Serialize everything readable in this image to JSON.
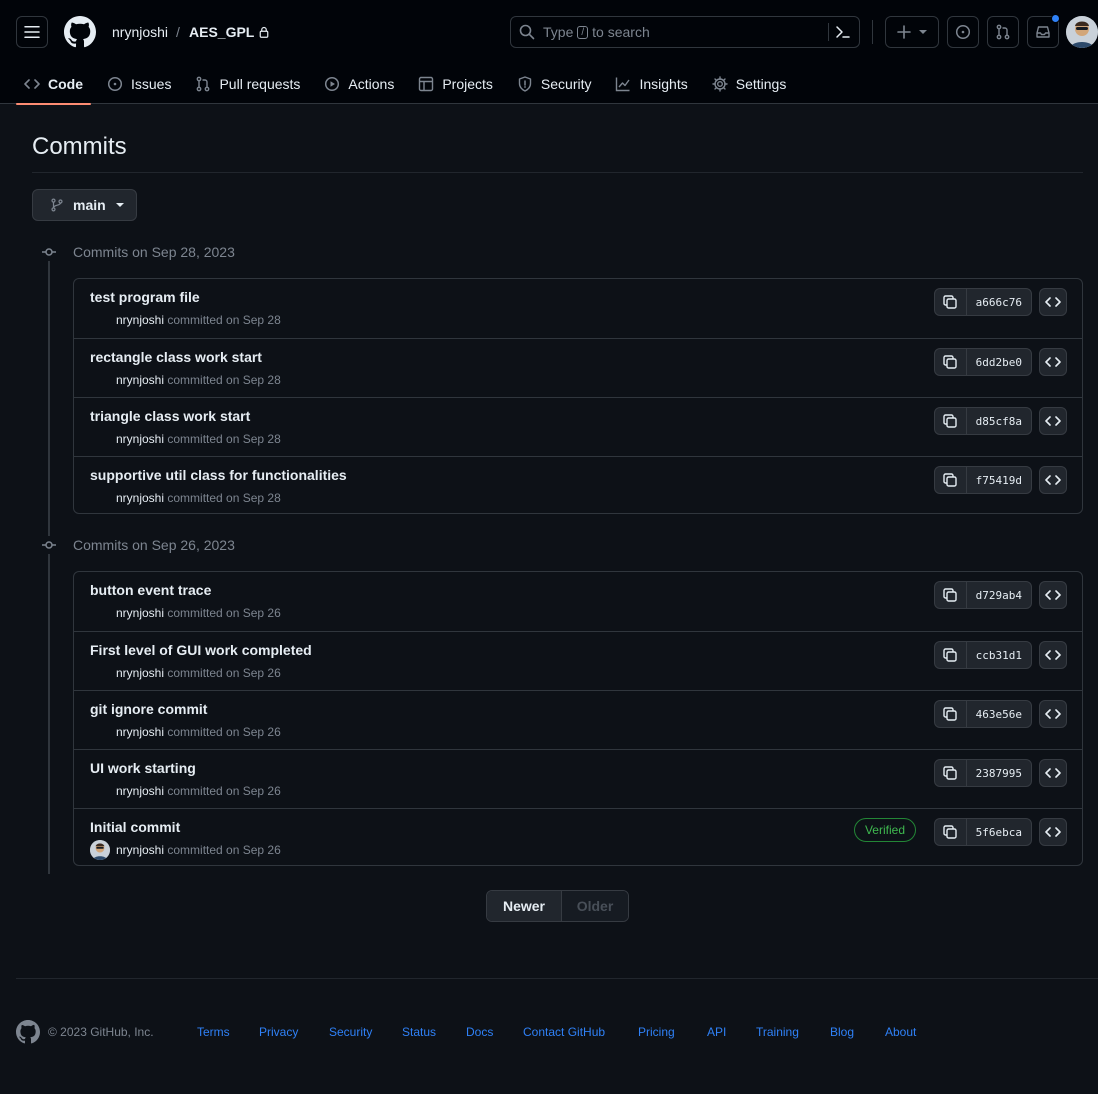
{
  "header": {
    "owner": "nrynjoshi",
    "separator": "/",
    "repo": "AES_GPL",
    "search_prefix": "Type",
    "search_key": "/",
    "search_suffix": "to search"
  },
  "tabs": [
    {
      "label": "Code",
      "icon": "code-icon"
    },
    {
      "label": "Issues",
      "icon": "issue-icon"
    },
    {
      "label": "Pull requests",
      "icon": "pull-request-icon"
    },
    {
      "label": "Actions",
      "icon": "play-icon"
    },
    {
      "label": "Projects",
      "icon": "table-icon"
    },
    {
      "label": "Security",
      "icon": "shield-icon"
    },
    {
      "label": "Insights",
      "icon": "graph-icon"
    },
    {
      "label": "Settings",
      "icon": "gear-icon"
    }
  ],
  "page": {
    "title": "Commits",
    "branch": "main"
  },
  "groups": [
    {
      "heading": "Commits on Sep 28, 2023",
      "commits": [
        {
          "message": "test program file",
          "author": "nrynjoshi",
          "committed": "committed on Sep 28",
          "sha": "a666c76"
        },
        {
          "message": "rectangle class work start",
          "author": "nrynjoshi",
          "committed": "committed on Sep 28",
          "sha": "6dd2be0"
        },
        {
          "message": "triangle class work start",
          "author": "nrynjoshi",
          "committed": "committed on Sep 28",
          "sha": "d85cf8a"
        },
        {
          "message": "supportive util class for functionalities",
          "author": "nrynjoshi",
          "committed": "committed on Sep 28",
          "sha": "f75419d"
        }
      ]
    },
    {
      "heading": "Commits on Sep 26, 2023",
      "commits": [
        {
          "message": "button event trace",
          "author": "nrynjoshi",
          "committed": "committed on Sep 26",
          "sha": "d729ab4"
        },
        {
          "message": "First level of GUI work completed",
          "author": "nrynjoshi",
          "committed": "committed on Sep 26",
          "sha": "ccb31d1"
        },
        {
          "message": "git ignore commit",
          "author": "nrynjoshi",
          "committed": "committed on Sep 26",
          "sha": "463e56e"
        },
        {
          "message": "UI work starting",
          "author": "nrynjoshi",
          "committed": "committed on Sep 26",
          "sha": "2387995"
        },
        {
          "message": "Initial commit",
          "author": "nrynjoshi",
          "committed": "committed on Sep 26",
          "sha": "5f6ebca",
          "badge": "Verified"
        }
      ]
    }
  ],
  "pager": {
    "newer": "Newer",
    "older": "Older"
  },
  "footer": {
    "copyright": "© 2023 GitHub, Inc.",
    "links": [
      "Terms",
      "Privacy",
      "Security",
      "Status",
      "Docs",
      "Contact GitHub",
      "Pricing",
      "API",
      "Training",
      "Blog",
      "About"
    ]
  },
  "colors": {
    "accent_underline": "#fd8c73",
    "link": "#2f81f7",
    "verified": "#3fb950",
    "notification": "#2f81f7"
  }
}
